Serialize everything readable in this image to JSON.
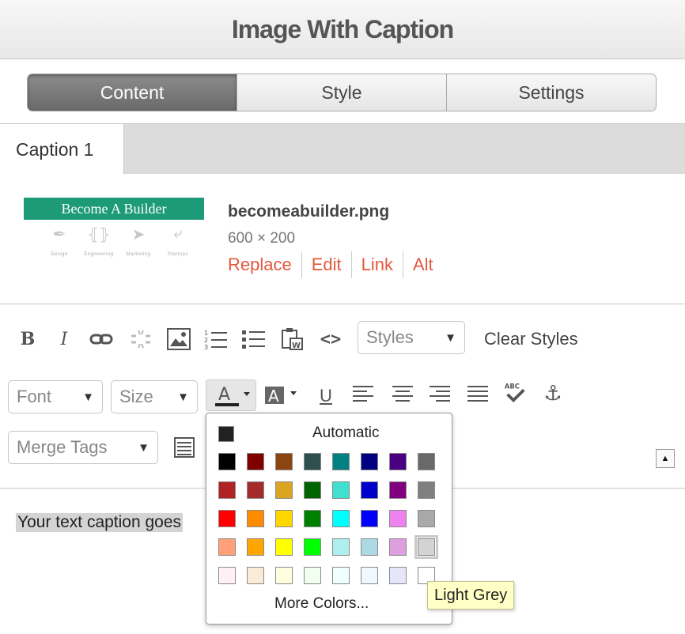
{
  "header": {
    "title": "Image With Caption"
  },
  "tabs": [
    {
      "label": "Content",
      "active": true
    },
    {
      "label": "Style",
      "active": false
    },
    {
      "label": "Settings",
      "active": false
    }
  ],
  "subtabs": [
    {
      "label": "Caption 1"
    }
  ],
  "image": {
    "thumbnail_text": "Become A Builder",
    "thumbnail_icons": [
      {
        "icon": "feather-icon",
        "label": "Design"
      },
      {
        "icon": "code-bracket-icon",
        "label": "Engineering"
      },
      {
        "icon": "paper-plane-icon",
        "label": "Marketing"
      },
      {
        "icon": "fork-arrow-icon",
        "label": "Startups"
      }
    ],
    "filename": "becomeabuilder.png",
    "dimensions": "600 × 200",
    "actions": [
      "Replace",
      "Edit",
      "Link",
      "Alt"
    ]
  },
  "toolbar": {
    "row1_icons": [
      "bold-icon",
      "italic-icon",
      "link-icon",
      "unlink-icon",
      "image-icon",
      "ordered-list-icon",
      "unordered-list-icon",
      "paste-word-icon",
      "source-code-icon"
    ],
    "styles_dropdown": "Styles",
    "clear_styles": "Clear Styles",
    "font_dropdown": "Font",
    "size_dropdown": "Size",
    "row2_icons": [
      "text-color-icon",
      "background-color-icon",
      "underline-icon",
      "align-left-icon",
      "align-center-icon",
      "align-right-icon",
      "justify-icon",
      "spellcheck-icon",
      "anchor-icon"
    ],
    "merge_tags_dropdown": "Merge Tags",
    "row3_icons": [
      "table-icon"
    ]
  },
  "editor": {
    "caption_text": "Your text caption goes"
  },
  "color_palette": {
    "automatic_label": "Automatic",
    "more_colors_label": "More Colors...",
    "selected_color_name": "Light Grey",
    "rows": [
      [
        "#000000",
        "#800000",
        "#8B4513",
        "#2F4F4F",
        "#008080",
        "#000080",
        "#4B0082",
        "#696969"
      ],
      [
        "#B22222",
        "#A52A2A",
        "#DAA520",
        "#006400",
        "#40E0D0",
        "#0000CD",
        "#800080",
        "#808080"
      ],
      [
        "#FF0000",
        "#FF8C00",
        "#FFD700",
        "#008000",
        "#00FFFF",
        "#0000FF",
        "#EE82EE",
        "#A9A9A9"
      ],
      [
        "#FFA07A",
        "#FFA500",
        "#FFFF00",
        "#00FF00",
        "#AFEEEE",
        "#ADD8E6",
        "#DDA0DD",
        "#D3D3D3"
      ],
      [
        "#FFF0F5",
        "#FAEBD7",
        "#FFFFE0",
        "#F0FFF0",
        "#F0FFFF",
        "#F0F8FF",
        "#E6E6FA",
        "#FFFFFF"
      ]
    ],
    "selected_row": 3,
    "selected_col": 7
  },
  "colors": {
    "link_accent": "#e2583e",
    "brand_green": "#1d9a77"
  }
}
